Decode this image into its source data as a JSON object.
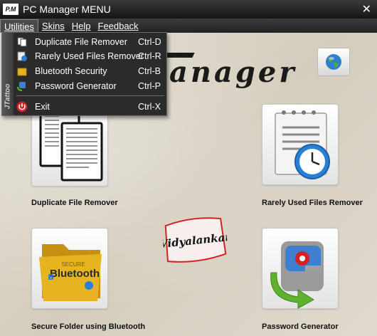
{
  "window": {
    "title": "PC Manager MENU",
    "icon_text": "P.M"
  },
  "menubar": {
    "items": [
      {
        "label": "Utilities",
        "accel": "U"
      },
      {
        "label": "Skins",
        "accel": "S"
      },
      {
        "label": "Help",
        "accel": "H"
      },
      {
        "label": "Feedback",
        "accel": "F"
      }
    ]
  },
  "dropdown": {
    "side_label": "JTattoo",
    "items": [
      {
        "label": "Duplicate File Remover",
        "shortcut": "Ctrl-D",
        "icon": "duplicate-files-icon"
      },
      {
        "label": "Rarely Used Files Remover",
        "shortcut": "Ctrl-R",
        "icon": "rarely-used-icon"
      },
      {
        "label": "Bluetooth Security",
        "shortcut": "Ctrl-B",
        "icon": "bluetooth-folder-icon"
      },
      {
        "label": "Password Generator",
        "shortcut": "Ctrl-P",
        "icon": "password-icon"
      }
    ],
    "exit": {
      "label": "Exit",
      "shortcut": "Ctrl-X",
      "icon": "power-icon"
    }
  },
  "logo": {
    "text": "anager"
  },
  "tiles": [
    {
      "label": "Duplicate File Remover",
      "icon": "documents-icon"
    },
    {
      "label": "Rarely Used Files Remover",
      "icon": "notepad-clock-icon"
    },
    {
      "label": "Secure Folder using Bluetooth",
      "icon": "bluetooth-folder-icon",
      "folder_text": "Bluetooth",
      "folder_top": "SECURE"
    },
    {
      "label": "Password Generator",
      "icon": "key-refresh-icon"
    }
  ],
  "center_logo": {
    "text": "Vidyalankar"
  },
  "colors": {
    "accent_red": "#d42222",
    "titlebar": "#1e1e1e",
    "folder": "#e6b321",
    "clock_blue": "#2a80d6"
  }
}
